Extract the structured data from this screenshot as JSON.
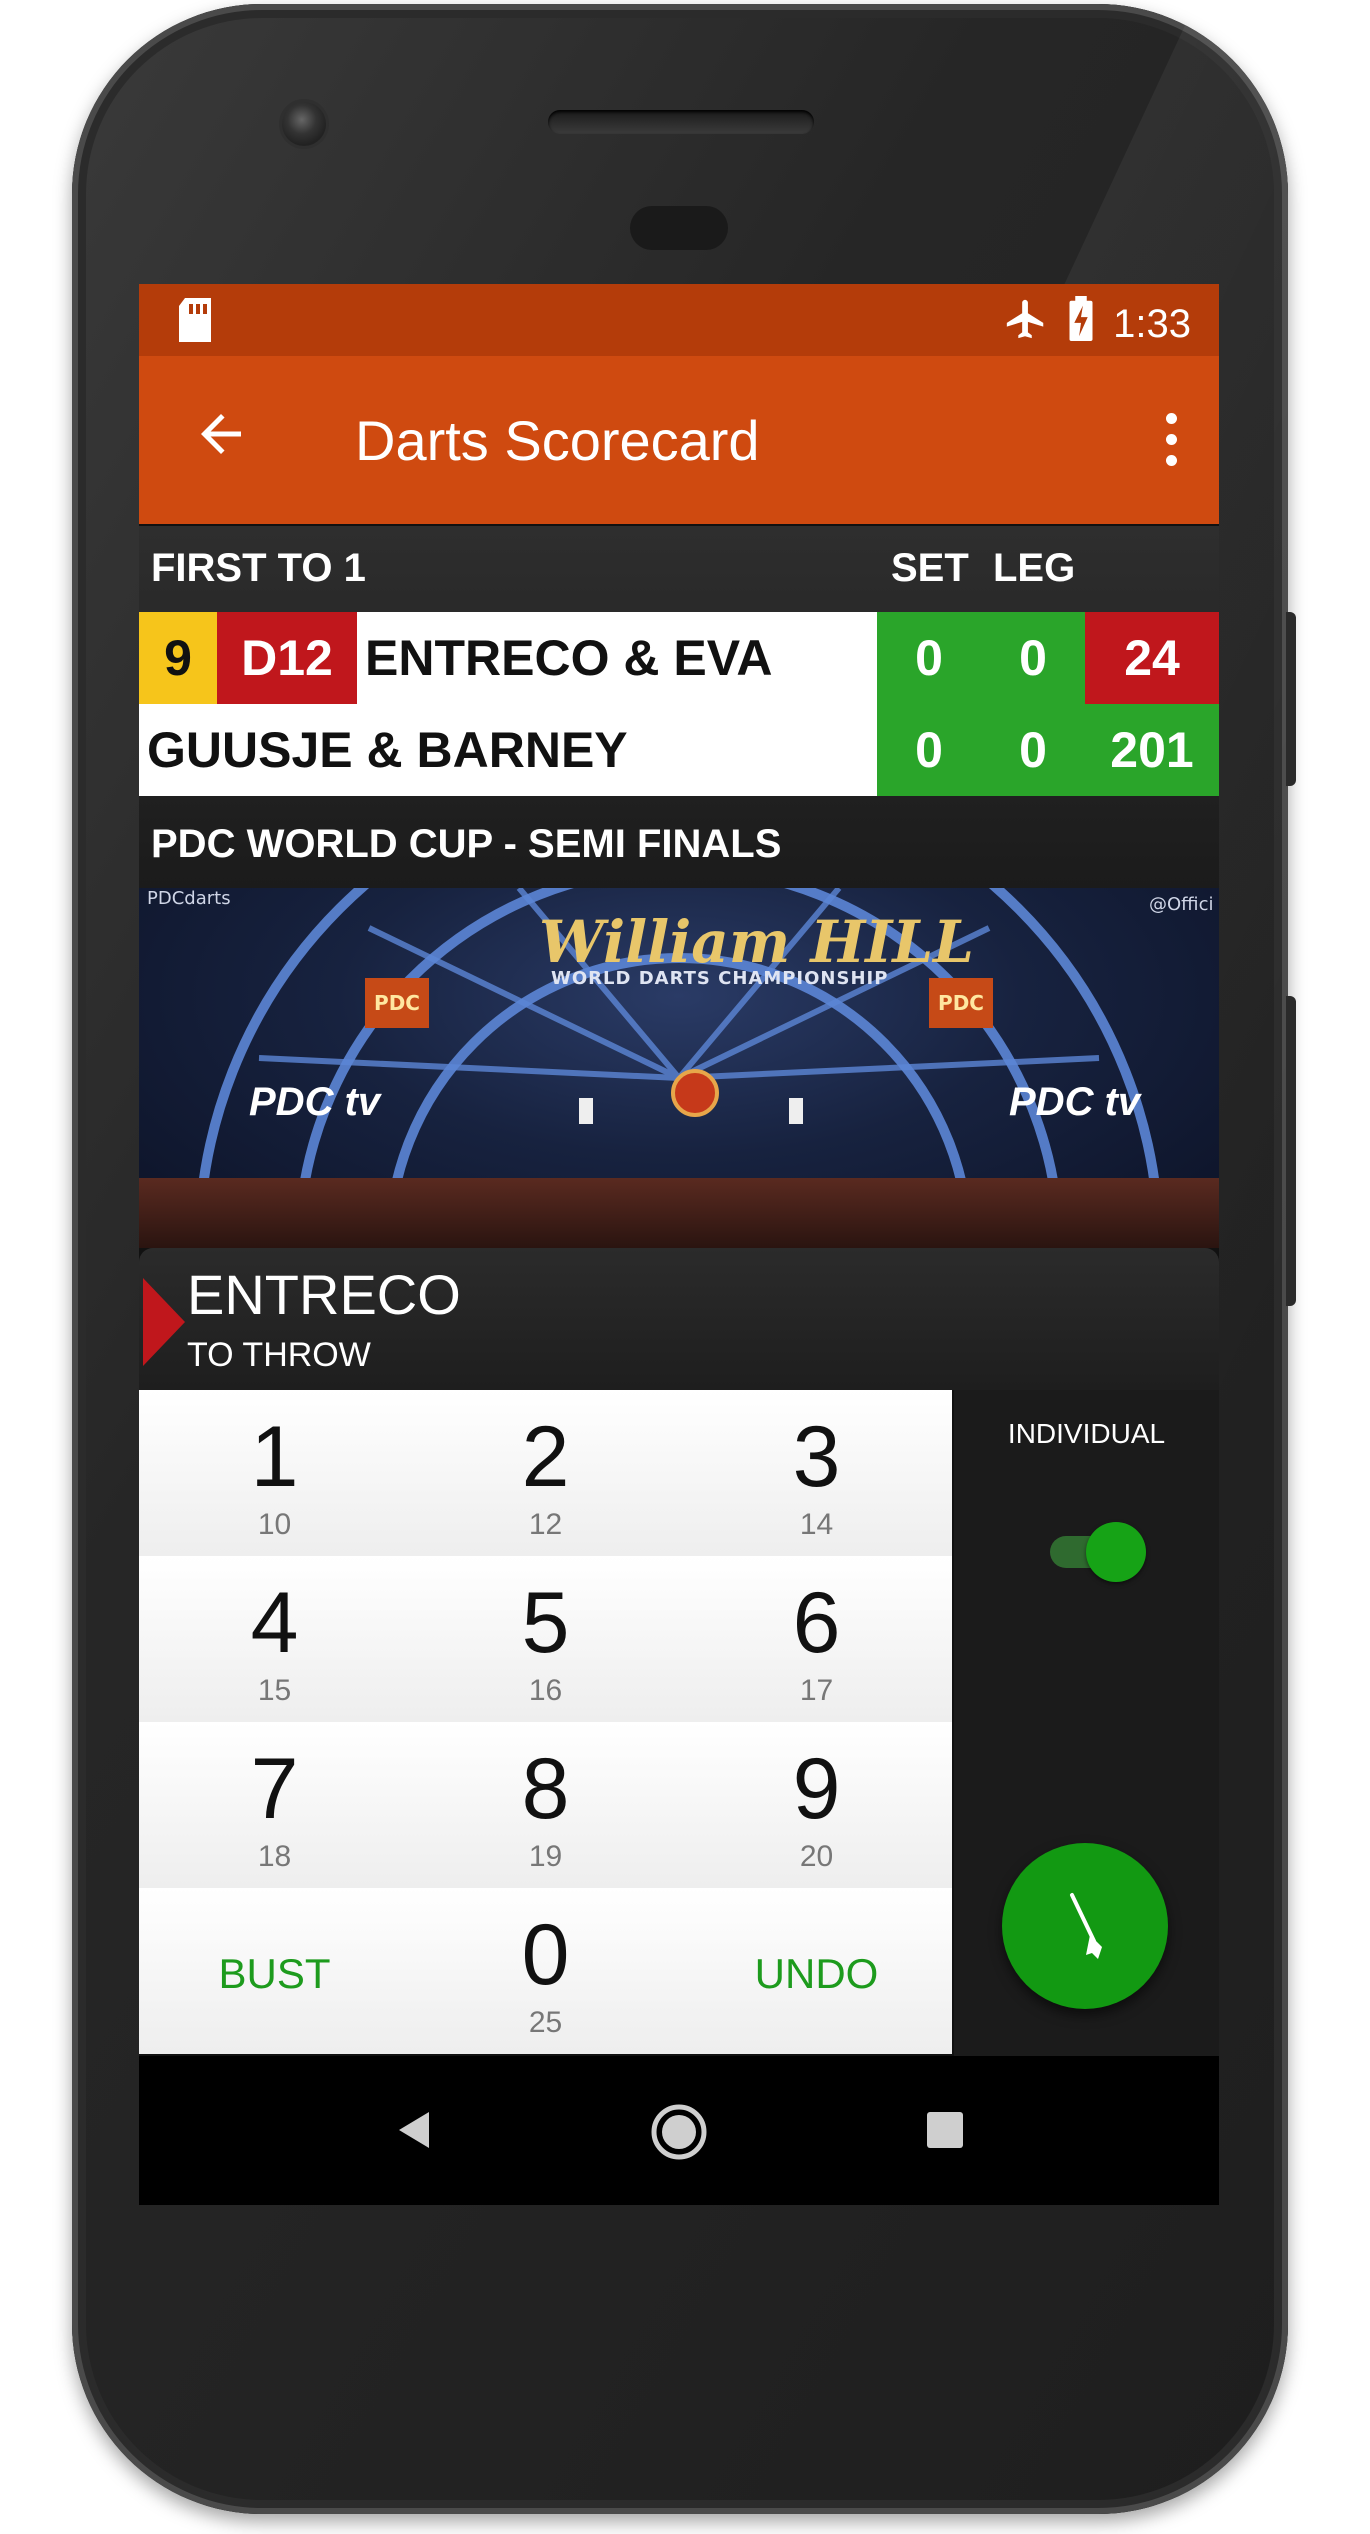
{
  "status_bar": {
    "time": "1:33",
    "icons": [
      "sd-card-icon",
      "airplane-mode-icon",
      "battery-charging-icon"
    ]
  },
  "app_bar": {
    "title": "Darts Scorecard",
    "back_icon": "arrow-back-icon",
    "menu_icon": "more-vert-icon"
  },
  "scoreboard": {
    "format": "FIRST TO 1",
    "set_header": "SET",
    "leg_header": "LEG",
    "players": [
      {
        "darts_thrown": "9",
        "checkout": "D12",
        "name": "ENTRECO & EVA",
        "to_throw": true,
        "sets": "0",
        "legs": "0",
        "score": "24"
      },
      {
        "name": "GUUSJE & BARNEY",
        "sets": "0",
        "legs": "0",
        "score": "201"
      }
    ],
    "event": "PDC WORLD CUP - SEMI FINALS"
  },
  "stage_image": {
    "logo_text": "William HILL",
    "subtitle": "WORLD DARTS CHAMPIONSHIP",
    "badge": "PDC",
    "tv_left": "PDC tv",
    "tv_right": "PDC tv",
    "corner_left": "PDCdarts",
    "corner_right": "@Offici"
  },
  "thrower": {
    "name": "ENTRECO",
    "label": "TO THROW"
  },
  "keypad": {
    "keys": [
      {
        "num": "1",
        "sub": "10"
      },
      {
        "num": "2",
        "sub": "12"
      },
      {
        "num": "3",
        "sub": "14"
      },
      {
        "num": "4",
        "sub": "15"
      },
      {
        "num": "5",
        "sub": "16"
      },
      {
        "num": "6",
        "sub": "17"
      },
      {
        "num": "7",
        "sub": "18"
      },
      {
        "num": "8",
        "sub": "19"
      },
      {
        "num": "9",
        "sub": "20"
      }
    ],
    "bust": "BUST",
    "zero": {
      "num": "0",
      "sub": "25"
    },
    "undo": "UNDO"
  },
  "side_panel": {
    "toggle_label": "INDIVIDUAL",
    "toggle_on": true,
    "fab_icon": "dart-icon"
  },
  "nav_bar": {
    "buttons": [
      "nav-back-icon",
      "nav-home-icon",
      "nav-recents-icon"
    ]
  },
  "colors": {
    "status_bar": "#b43c0a",
    "app_bar": "#cf4a10",
    "green": "#2aa52a",
    "red": "#c0171c",
    "yellow": "#f6c51b"
  }
}
